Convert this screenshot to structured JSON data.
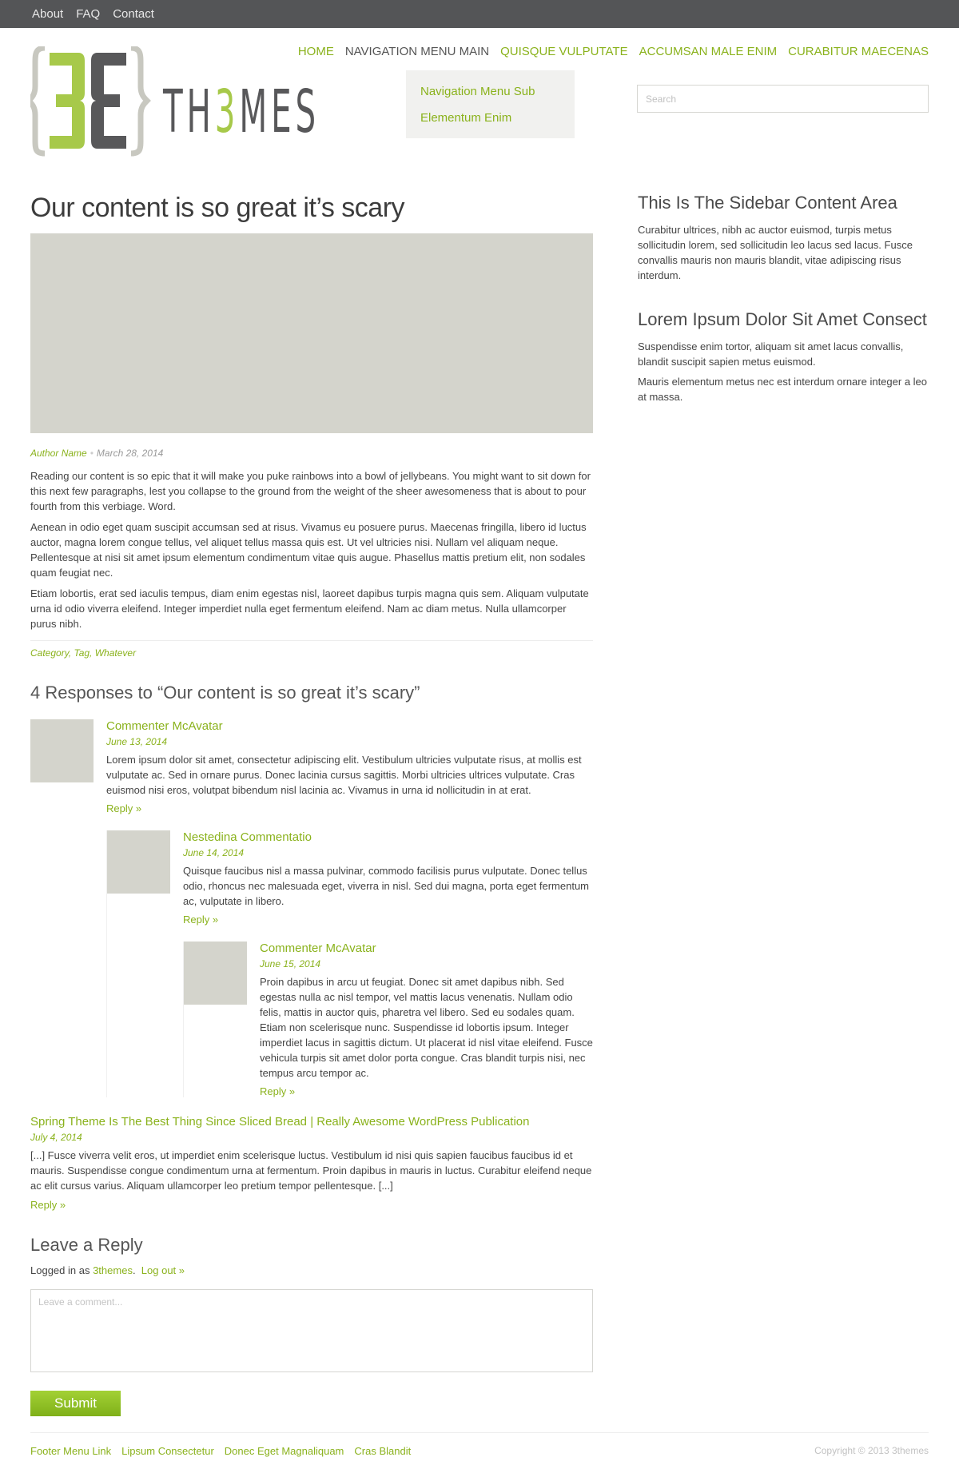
{
  "topbar": {
    "links": [
      "About",
      "FAQ",
      "Contact"
    ]
  },
  "logo": {
    "mark": "{3Ɛ}",
    "text_pre": "TH",
    "text_accent": "3",
    "text_post": "MES"
  },
  "nav": {
    "items": [
      "HOME",
      "NAVIGATION MENU MAIN",
      "QUISQUE VULPUTATE",
      "ACCUMSAN MALE ENIM",
      "CURABITUR MAECENAS"
    ],
    "submenu": [
      "Navigation Menu Sub",
      "Elementum Enim"
    ]
  },
  "search": {
    "placeholder": "Search"
  },
  "post": {
    "title": "Our content is so great it’s scary",
    "author": "Author Name",
    "date": "March 28, 2014",
    "paragraphs": [
      "Reading our content is so epic that it will make you puke rainbows into a bowl of jellybeans. You might want to sit down for this next few paragraphs, lest you collapse to the ground from the weight of the sheer awesomeness that is about to pour fourth from this verbiage. Word.",
      "Aenean in odio eget quam suscipit accumsan sed at risus. Vivamus eu posuere purus. Maecenas fringilla, libero id luctus auctor, magna lorem congue tellus, vel aliquet tellus massa quis est. Ut vel ultricies nisi. Nullam vel aliquam neque. Pellentesque at nisi sit amet ipsum elementum condimentum vitae quis augue. Phasellus mattis pretium elit, non sodales quam feugiat nec.",
      "Etiam lobortis, erat sed iaculis tempus, diam enim egestas nisl, laoreet dapibus turpis magna quis sem. Aliquam vulputate urna id odio viverra eleifend. Integer imperdiet nulla eget fermentum eleifend. Nam ac diam metus. Nulla ullamcorper purus nibh."
    ],
    "tags": "Category, Tag, Whatever"
  },
  "responses": {
    "title": "4 Responses to “Our content is so great it’s scary”",
    "comments": [
      {
        "name": "Commenter McAvatar",
        "date": "June 13, 2014",
        "text": "Lorem ipsum dolor sit amet, consectetur adipiscing elit. Vestibulum ultricies vulputate risus, at mollis est vulputate ac. Sed in ornare purus. Donec lacinia cursus sagittis. Morbi ultricies ultrices vulputate. Cras euismod nisi eros, volutpat bibendum nisl lacinia ac. Vivamus in urna id nollicitudin in at erat.",
        "reply": "Reply »"
      },
      {
        "name": "Nestedina Commentatio",
        "date": "June 14, 2014",
        "text": "Quisque faucibus nisl a massa pulvinar, commodo facilisis purus vulputate. Donec tellus odio, rhoncus nec malesuada eget, viverra in nisl. Sed dui magna, porta eget fermentum ac, vulputate in libero.",
        "reply": "Reply »"
      },
      {
        "name": "Commenter McAvatar",
        "date": "June 15, 2014",
        "text": "Proin dapibus in arcu ut feugiat. Donec sit amet dapibus nibh. Sed egestas nulla ac nisl tempor, vel mattis lacus venenatis. Nullam odio felis, mattis in auctor quis, pharetra vel libero. Sed eu sodales quam. Etiam non scelerisque nunc. Suspendisse id lobortis ipsum. Integer imperdiet lacus in sagittis dictum. Ut placerat id nisl vitae eleifend. Fusce vehicula turpis sit amet dolor porta congue. Cras blandit turpis nisi, nec tempus arcu tempor ac.",
        "reply": "Reply »"
      }
    ],
    "pingback": {
      "title": "Spring Theme Is The Best Thing Since Sliced Bread | Really Awesome WordPress Publication",
      "date": "July 4, 2014",
      "text": "[...] Fusce viverra velit eros, ut imperdiet enim scelerisque luctus. Vestibulum id nisi quis sapien faucibus faucibus id et mauris. Suspendisse congue condimentum urna at fermentum. Proin dapibus in mauris in luctus. Curabitur eleifend neque ac elit cursus varius. Aliquam ullamcorper leo pretium tempor pellentesque. [...]",
      "reply": "Reply »"
    }
  },
  "reply_form": {
    "title": "Leave a Reply",
    "logged_prefix": "Logged in as",
    "username": "3themes",
    "logout": "Log out »",
    "placeholder": "Leave a comment...",
    "submit": "Submit"
  },
  "sidebar": {
    "widgets": [
      {
        "title": "This Is The Sidebar Content Area",
        "paragraphs": [
          "Curabitur ultrices, nibh ac auctor euismod, turpis metus sollicitudin lorem, sed sollicitudin leo lacus sed lacus. Fusce convallis mauris non mauris blandit, vitae adipiscing risus interdum."
        ]
      },
      {
        "title": "Lorem Ipsum Dolor Sit Amet Consect",
        "paragraphs": [
          "Suspendisse enim tortor, aliquam sit amet lacus convallis, blandit suscipit sapien metus euismod.",
          "Mauris elementum metus nec est interdum ornare integer a leo at massa."
        ]
      }
    ]
  },
  "footer": {
    "links": [
      "Footer Menu Link",
      "Lipsum Consectetur",
      "Donec Eget Magnaliquam",
      "Cras Blandit"
    ],
    "copyright": "Copyright © 2013 3themes"
  },
  "colors": {
    "accent": "#8ab21c",
    "topbar": "#545557",
    "placeholder_gray": "#d4d4cc",
    "logo_dark": "#58585a",
    "logo_light": "#c8c8c0"
  }
}
